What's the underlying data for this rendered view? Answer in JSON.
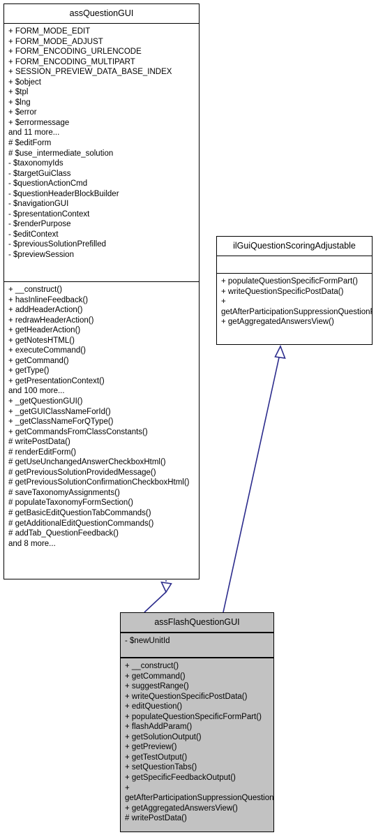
{
  "diagram": {
    "type": "uml-class-diagram",
    "background_color": "#ffffff",
    "line_color": "#000000",
    "connector_color": "#2b2b8c",
    "filled_box_color": "#c2c2c2"
  },
  "classes": {
    "assQuestionGUI": {
      "name": "assQuestionGUI",
      "attributes": [
        "+ FORM_MODE_EDIT",
        "+ FORM_MODE_ADJUST",
        "+ FORM_ENCODING_URLENCODE",
        "+ FORM_ENCODING_MULTIPART",
        "+ SESSION_PREVIEW_DATA_BASE_INDEX",
        "+ $object",
        "+ $tpl",
        "+ $lng",
        "+ $error",
        "+ $errormessage",
        "and 11 more...",
        "# $editForm",
        "# $use_intermediate_solution",
        "- $taxonomyIds",
        "- $targetGuiClass",
        "- $questionActionCmd",
        "- $questionHeaderBlockBuilder",
        "- $navigationGUI",
        "- $presentationContext",
        "- $renderPurpose",
        "- $editContext",
        "- $previousSolutionPrefilled",
        "- $previewSession"
      ],
      "operations": [
        "+ __construct()",
        "+ hasInlineFeedback()",
        "+ addHeaderAction()",
        "+ redrawHeaderAction()",
        "+ getHeaderAction()",
        "+ getNotesHTML()",
        "+ executeCommand()",
        "+ getCommand()",
        "+ getType()",
        "+ getPresentationContext()",
        "and 100 more...",
        "+ _getQuestionGUI()",
        "+ _getGUIClassNameForId()",
        "+ _getClassNameForQType()",
        "+ getCommandsFromClassConstants()",
        "# writePostData()",
        "# renderEditForm()",
        "# getUseUnchangedAnswerCheckboxHtml()",
        "# getPreviousSolutionProvidedMessage()",
        "# getPreviousSolutionConfirmationCheckboxHtml()",
        "# saveTaxonomyAssignments()",
        "# populateTaxonomyFormSection()",
        "# getBasicEditQuestionTabCommands()",
        "# getAdditionalEditQuestionCommands()",
        "# addTab_QuestionFeedback()",
        "and 8 more..."
      ]
    },
    "ilGuiQuestionScoringAdjustable": {
      "name": "ilGuiQuestionScoringAdjustable",
      "attributes": [],
      "operations": [
        "+ populateQuestionSpecificFormPart()",
        "+ writeQuestionSpecificPostData()",
        "+ getAfterParticipationSuppressionQuestionPostVars()",
        "+ getAggregatedAnswersView()"
      ]
    },
    "assFlashQuestionGUI": {
      "name": "assFlashQuestionGUI",
      "attributes": [
        "- $newUnitId"
      ],
      "operations": [
        "+ __construct()",
        "+ getCommand()",
        "+ suggestRange()",
        "+ writeQuestionSpecificPostData()",
        "+ editQuestion()",
        "+ populateQuestionSpecificFormPart()",
        "+ flashAddParam()",
        "+ getSolutionOutput()",
        "+ getPreview()",
        "+ getTestOutput()",
        "+ setQuestionTabs()",
        "+ getSpecificFeedbackOutput()",
        "+ getAfterParticipationSuppressionQuestionPostVars()",
        "+ getAggregatedAnswersView()",
        "# writePostData()"
      ]
    }
  },
  "relationships": [
    {
      "name": "generalization-assFlashQuestionGUI-to-assQuestionGUI",
      "from": "assFlashQuestionGUI",
      "to": "assQuestionGUI",
      "kind": "generalization"
    },
    {
      "name": "realization-assFlashQuestionGUI-to-ilGuiQuestionScoringAdjustable",
      "from": "assFlashQuestionGUI",
      "to": "ilGuiQuestionScoringAdjustable",
      "kind": "realization"
    }
  ]
}
